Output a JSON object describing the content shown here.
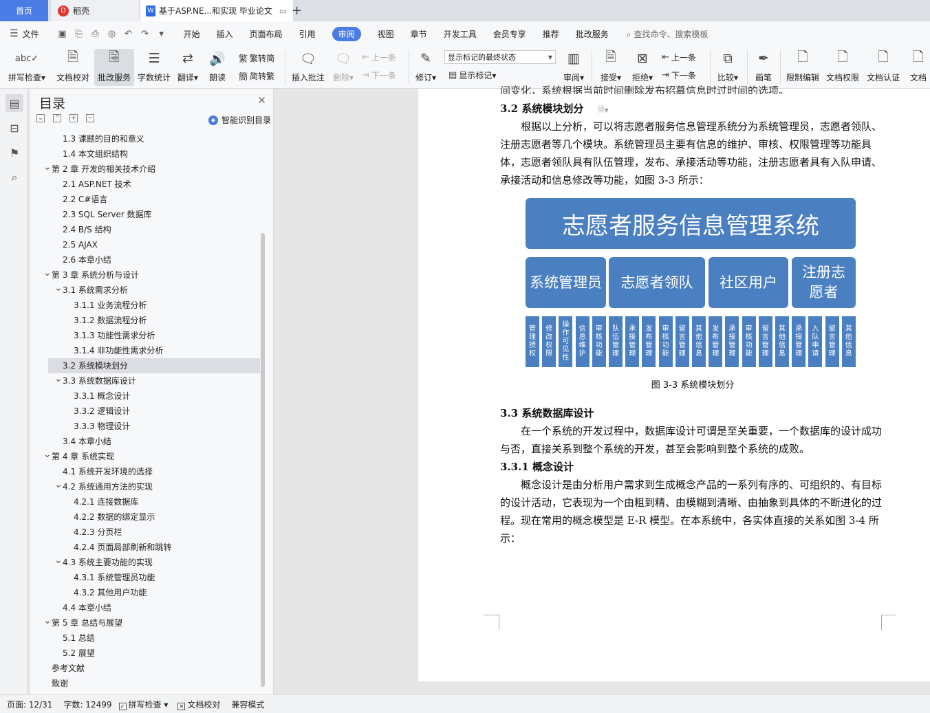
{
  "tabs": {
    "home": "首页",
    "daoke": "稻壳",
    "doc": "基于ASP.NE...和实现 毕业论文",
    "plus": "+"
  },
  "menu": {
    "file": "文件",
    "items": [
      "开始",
      "插入",
      "页面布局",
      "引用",
      "审阅",
      "视图",
      "章节",
      "开发工具",
      "会员专享",
      "推荐",
      "批改服务"
    ],
    "search": "查找命令、搜索模板"
  },
  "ribbon": {
    "spell": "拼写检查",
    "proof": "文档校对",
    "pigai": "批改服务",
    "wordcount": "字数统计",
    "translate": "翻译",
    "read": "朗读",
    "fan2jian": "繁转简",
    "jian2fan": "简转繁",
    "insert_comment": "插入批注",
    "delete": "删除",
    "prev1": "上一条",
    "next1": "下一条",
    "revise": "修订",
    "show_state": "显示标记的最终状态",
    "show_marks": "显示标记",
    "review": "审阅",
    "accept": "接受",
    "reject": "拒绝",
    "prev2": "上一条",
    "next2": "下一条",
    "compare": "比较",
    "pen": "画笔",
    "restrict": "限制编辑",
    "rights": "文档权限",
    "auth": "文档认证",
    "more": "文档"
  },
  "toc": {
    "title": "目录",
    "smart": "智能识别目录",
    "items": [
      {
        "text": "1.3  课题的目的和意义",
        "level": 2,
        "chev": ""
      },
      {
        "text": "1.4  本文组织结构",
        "level": 2,
        "chev": ""
      },
      {
        "text": "第 2 章  开发的相关技术介绍",
        "level": 1,
        "chev": "v"
      },
      {
        "text": "2.1 ASP.NET 技术",
        "level": 2,
        "chev": ""
      },
      {
        "text": "2.2 C#语言",
        "level": 2,
        "chev": ""
      },
      {
        "text": "2.3 SQL Server 数据库",
        "level": 2,
        "chev": ""
      },
      {
        "text": "2.4 B/S 结构",
        "level": 2,
        "chev": ""
      },
      {
        "text": "2.5 AJAX",
        "level": 2,
        "chev": ""
      },
      {
        "text": "2.6  本章小结",
        "level": 2,
        "chev": ""
      },
      {
        "text": "第 3 章  系统分析与设计",
        "level": 1,
        "chev": "v"
      },
      {
        "text": "3.1  系统需求分析",
        "level": 2,
        "chev": "v"
      },
      {
        "text": "3.1.1  业务流程分析",
        "level": 3,
        "chev": ""
      },
      {
        "text": "3.1.2  数据流程分析",
        "level": 3,
        "chev": ""
      },
      {
        "text": "3.1.3  功能性需求分析",
        "level": 3,
        "chev": ""
      },
      {
        "text": "3.1.4  非功能性需求分析",
        "level": 3,
        "chev": ""
      },
      {
        "text": "3.2  系统模块划分",
        "level": 2,
        "chev": "",
        "selected": true
      },
      {
        "text": "3.3  系统数据库设计",
        "level": 2,
        "chev": "v"
      },
      {
        "text": "3.3.1  概念设计",
        "level": 3,
        "chev": ""
      },
      {
        "text": "3.3.2  逻辑设计",
        "level": 3,
        "chev": ""
      },
      {
        "text": "3.3.3  物理设计",
        "level": 3,
        "chev": ""
      },
      {
        "text": "3.4  本章小结",
        "level": 2,
        "chev": ""
      },
      {
        "text": "第 4 章  系统实现",
        "level": 1,
        "chev": "v"
      },
      {
        "text": "4.1  系统开发环境的选择",
        "level": 2,
        "chev": ""
      },
      {
        "text": "4.2  系统通用方法的实现",
        "level": 2,
        "chev": "v"
      },
      {
        "text": "4.2.1  连接数据库",
        "level": 3,
        "chev": ""
      },
      {
        "text": "4.2.2  数据的绑定显示",
        "level": 3,
        "chev": ""
      },
      {
        "text": "4.2.3  分页栏",
        "level": 3,
        "chev": ""
      },
      {
        "text": "4.2.4  页面局部刷新和跳转",
        "level": 3,
        "chev": ""
      },
      {
        "text": "4.3  系统主要功能的实现",
        "level": 2,
        "chev": "v"
      },
      {
        "text": "4.3.1  系统管理员功能",
        "level": 3,
        "chev": ""
      },
      {
        "text": "4.3.2  其他用户功能",
        "level": 3,
        "chev": ""
      },
      {
        "text": "4.4  本章小结",
        "level": 2,
        "chev": ""
      },
      {
        "text": "第 5 章  总结与展望",
        "level": 1,
        "chev": "v"
      },
      {
        "text": "5.1  总结",
        "level": 2,
        "chev": ""
      },
      {
        "text": "5.2  展望",
        "level": 2,
        "chev": ""
      },
      {
        "text": "参考文献",
        "level": 1,
        "chev": ""
      },
      {
        "text": "致谢",
        "level": 1,
        "chev": ""
      }
    ]
  },
  "doc": {
    "cut_line": "间变化，系统根据当前时间删除发布招募信息时过时间的选项。",
    "h32": "3.2  系统模块划分",
    "p32": "根据以上分析，可以将志愿者服务信息管理系统分为系统管理员，志愿者领队、注册志愿者等几个模块。系统管理员主要有信息的维护、审核、权限管理等功能具体，志愿者领队具有队伍管理，发布、承接活动等功能，注册志愿者具有入队申请、承接活动和信息修改等功能，如图 3-3 所示：",
    "figure": {
      "title": "志愿者服务信息管理系统",
      "groups": [
        "系统管理员",
        "志愿者领队",
        "社区用户",
        "注册志愿者"
      ],
      "leaves": [
        "管理授权",
        "修改权限",
        "操作可见性",
        "信息维护",
        "审核功能",
        "队伍管理",
        "承接管理",
        "发布管理",
        "审核功能",
        "留言管理",
        "其他信息",
        "发布管理",
        "承接管理",
        "审核功能",
        "留言管理",
        "其他信息",
        "承接管理",
        "入队申请",
        "留言管理",
        "其他信息"
      ]
    },
    "caption": "图 3-3 系统模块划分",
    "h33": "3.3  系统数据库设计",
    "p33": "在一个系统的开发过程中，数据库设计可谓是至关重要，一个数据库的设计成功与否，直接关系到整个系统的开发，甚至会影响到整个系统的成败。",
    "h331": "3.3.1  概念设计",
    "p331": "概念设计是由分析用户需求到生成概念产品的一系列有序的、可组织的、有目标的设计活动，它表现为一个由粗到精、由模糊到清晰、由抽象到具体的不断进化的过程。现在常用的概念模型是 E-R 模型。在本系统中，各实体直接的关系如图 3-4 所示："
  },
  "status": {
    "page": "页面: 12/31",
    "words": "字数: 12499",
    "spell": "拼写检查",
    "proof": "文档校对",
    "compat": "兼容模式"
  }
}
